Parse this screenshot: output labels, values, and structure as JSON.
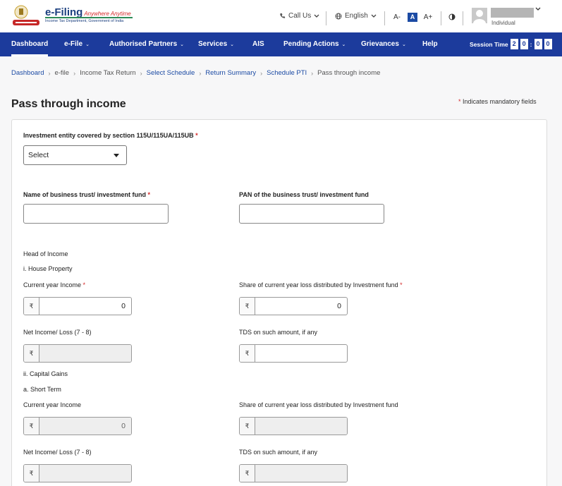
{
  "header": {
    "logo_title": "e-Filing",
    "logo_tagline": "Anywhere Anytime",
    "logo_subtitle": "Income Tax Department, Government of India",
    "call_us": "Call Us",
    "language": "English",
    "font_decrease": "A-",
    "font_normal": "A",
    "font_increase": "A+",
    "user_role": "Individual"
  },
  "nav": {
    "items": [
      {
        "label": "Dashboard"
      },
      {
        "label": "e-File"
      },
      {
        "label": "Authorised Partners"
      },
      {
        "label": "Services"
      },
      {
        "label": "AIS"
      },
      {
        "label": "Pending Actions"
      },
      {
        "label": "Grievances"
      },
      {
        "label": "Help"
      }
    ],
    "session_label": "Session Time",
    "session_digits": [
      "2",
      "0",
      "0",
      "0"
    ]
  },
  "breadcrumb": {
    "items": [
      "Dashboard",
      "e-file",
      "Income Tax Return",
      "Select Schedule",
      "Return Summary",
      "Schedule PTI",
      "Pass through income"
    ]
  },
  "page": {
    "title": "Pass through income",
    "mandatory_note": "Indicates mandatory fields"
  },
  "form": {
    "investment_entity_label": "Investment entity covered by section 115U/115UA/115UB",
    "investment_entity_value": "Select",
    "trust_name_label": "Name of business trust/ investment fund",
    "trust_pan_label": "PAN of the business trust/ investment fund",
    "head_of_income": "Head of Income",
    "house_property": "i. House Property",
    "current_year_income": "Current year Income",
    "share_loss": "Share of current year loss distributed by Investment fund",
    "net_income": "Net Income/ Loss (7 - 8)",
    "tds": "TDS on such amount, if any",
    "capital_gains": "ii. Capital Gains",
    "short_term": "a. Short Term",
    "currency": "₹",
    "hp_current_income_value": "0",
    "hp_share_loss_value": "0",
    "st_current_income_value": "0"
  }
}
